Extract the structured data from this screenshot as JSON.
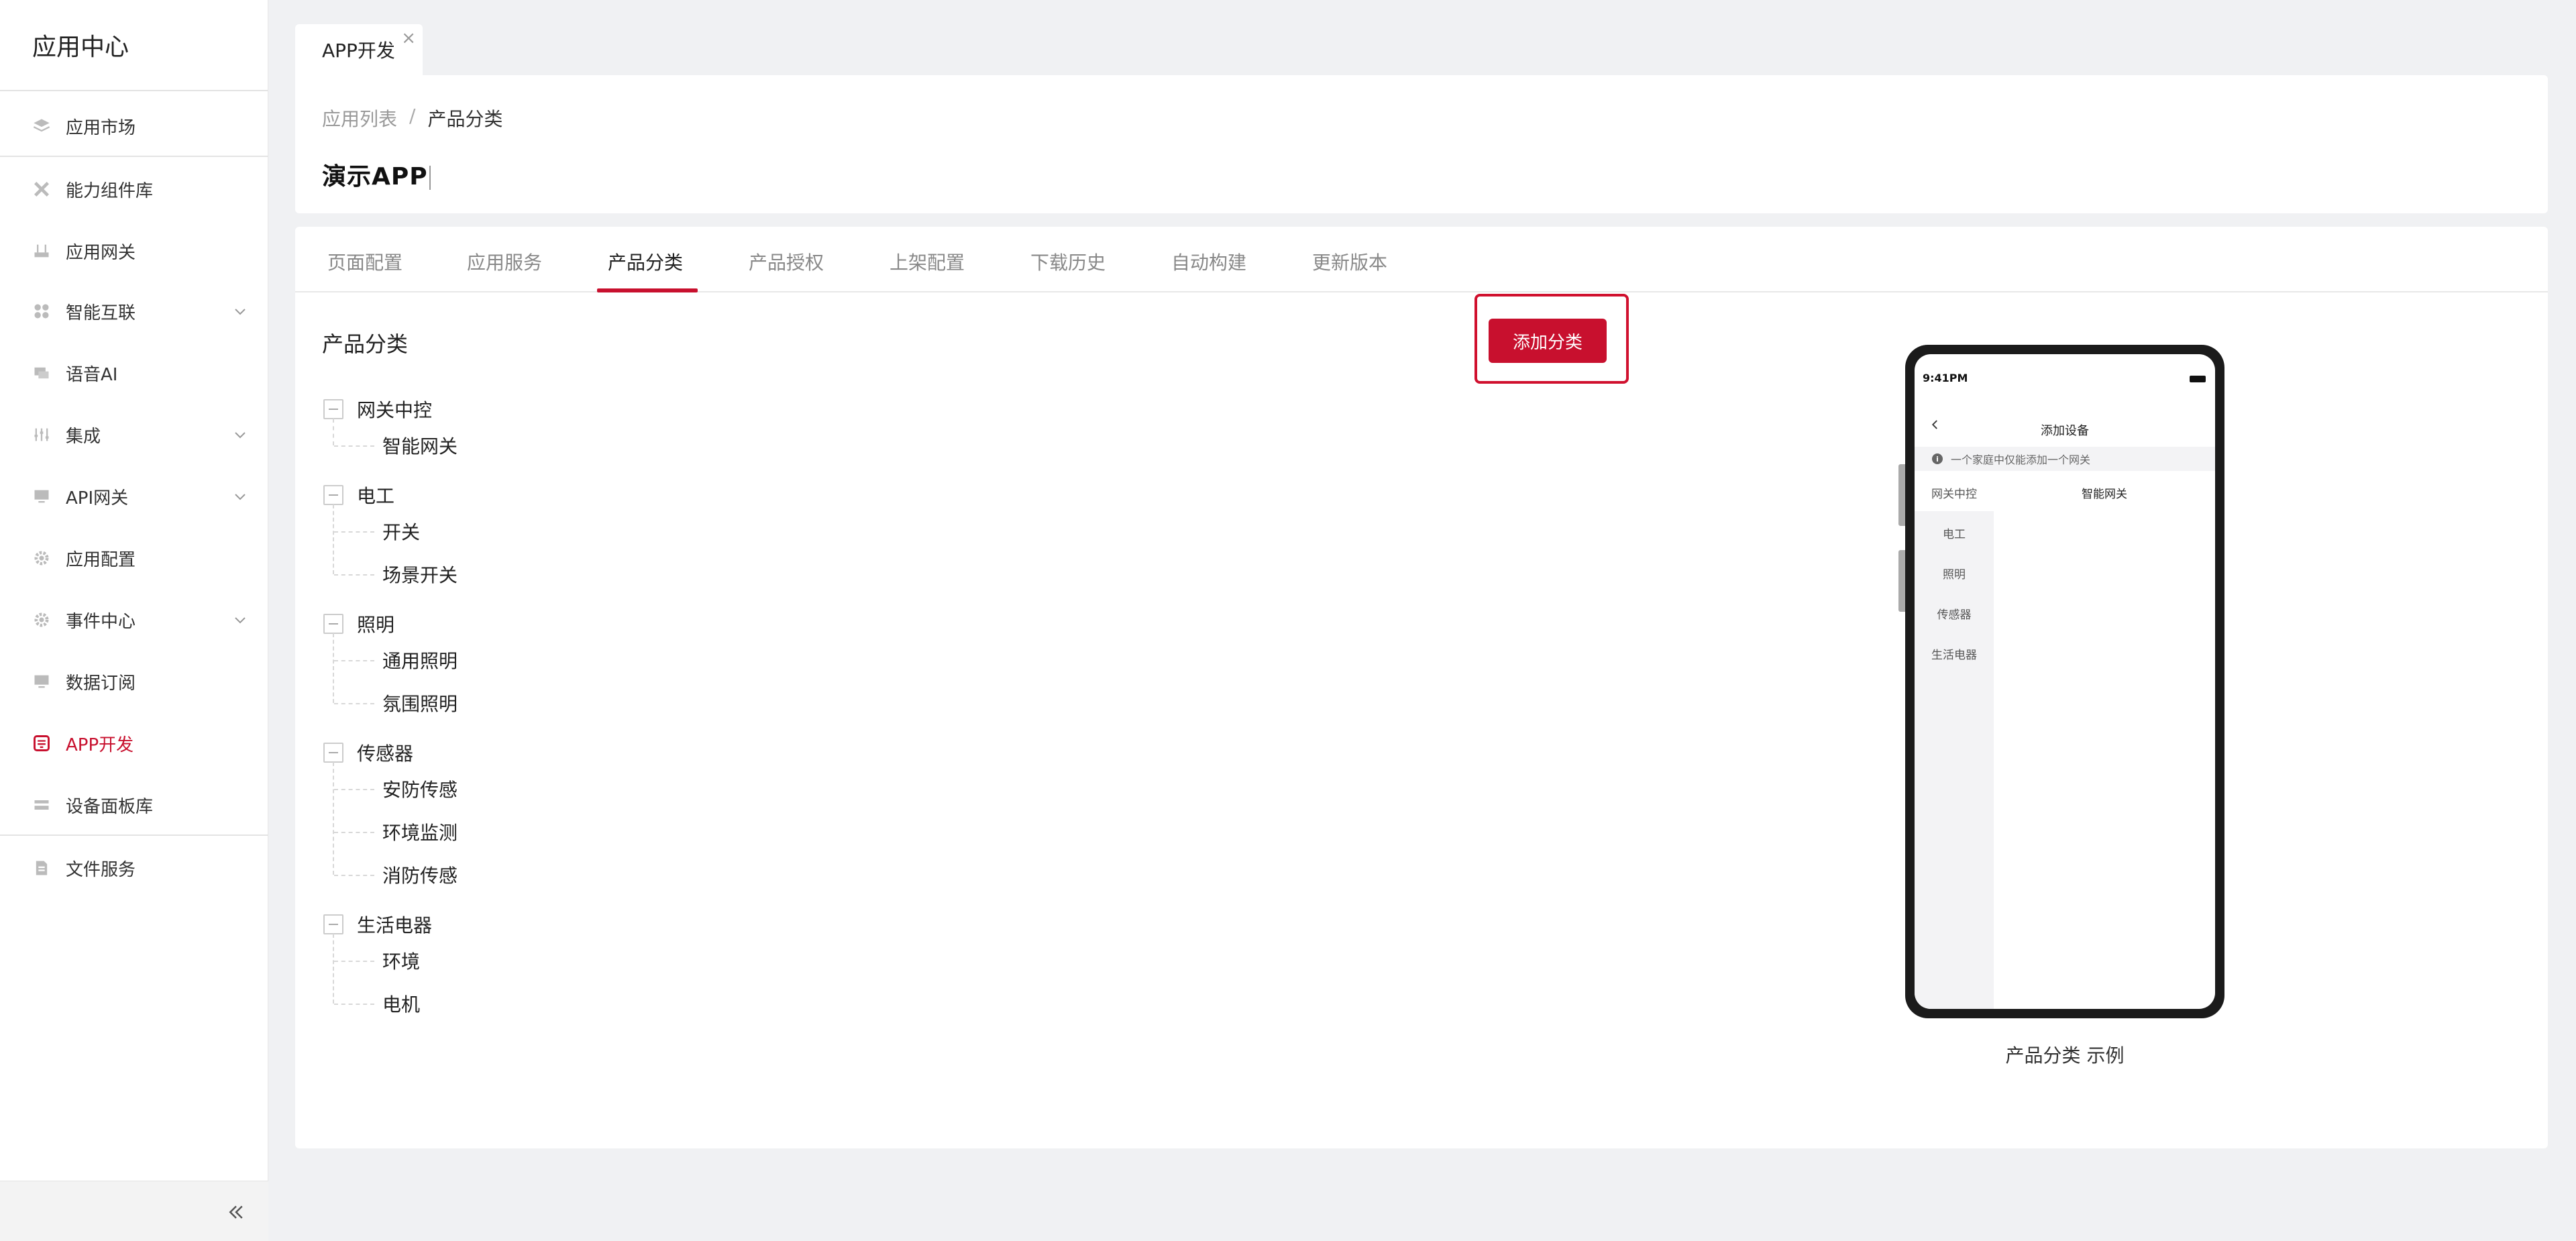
{
  "app": {
    "title": "应用中心"
  },
  "sidebar": {
    "items": [
      {
        "label": "应用市场",
        "icon": "layers-icon"
      },
      {
        "label": "能力组件库",
        "icon": "tools-icon"
      },
      {
        "label": "应用网关",
        "icon": "router-icon"
      },
      {
        "label": "智能互联",
        "icon": "grid-icon",
        "expandable": true
      },
      {
        "label": "语音AI",
        "icon": "chat-icon"
      },
      {
        "label": "集成",
        "icon": "sliders-icon",
        "expandable": true
      },
      {
        "label": "API网关",
        "icon": "monitor-icon",
        "expandable": true
      },
      {
        "label": "应用配置",
        "icon": "gear-icon"
      },
      {
        "label": "事件中心",
        "icon": "gear-icon",
        "expandable": true
      },
      {
        "label": "数据订阅",
        "icon": "monitor-icon"
      },
      {
        "label": "APP开发",
        "icon": "app-icon",
        "active": true
      },
      {
        "label": "设备面板库",
        "icon": "panel-icon"
      },
      {
        "label": "文件服务",
        "icon": "file-icon"
      }
    ]
  },
  "page_tab": {
    "label": "APP开发",
    "close": "×"
  },
  "breadcrumb": {
    "parent": "应用列表",
    "separator": "/",
    "current": "产品分类"
  },
  "page_title": "演示APP",
  "tabs": [
    {
      "label": "页面配置"
    },
    {
      "label": "应用服务"
    },
    {
      "label": "产品分类",
      "active": true
    },
    {
      "label": "产品授权"
    },
    {
      "label": "上架配置"
    },
    {
      "label": "下载历史"
    },
    {
      "label": "自动构建"
    },
    {
      "label": "更新版本"
    }
  ],
  "section": {
    "title": "产品分类",
    "add_button": "添加分类"
  },
  "tree": [
    {
      "label": "网关中控",
      "children": [
        "智能网关"
      ]
    },
    {
      "label": "电工",
      "children": [
        "开关",
        "场景开关"
      ]
    },
    {
      "label": "照明",
      "children": [
        "通用照明",
        "氛围照明"
      ]
    },
    {
      "label": "传感器",
      "children": [
        "安防传感",
        "环境监测",
        "消防传感"
      ]
    },
    {
      "label": "生活电器",
      "children": [
        "环境",
        "电机"
      ]
    }
  ],
  "phone": {
    "time": "9:41PM",
    "title": "添加设备",
    "notice": "一个家庭中仅能添加一个网关",
    "info_icon": "i",
    "categories": [
      "网关中控",
      "电工",
      "照明",
      "传感器",
      "生活电器"
    ],
    "subcategory": "智能网关",
    "caption": "产品分类 示例"
  },
  "colors": {
    "accent": "#c8102e",
    "background": "#f0f1f3"
  }
}
